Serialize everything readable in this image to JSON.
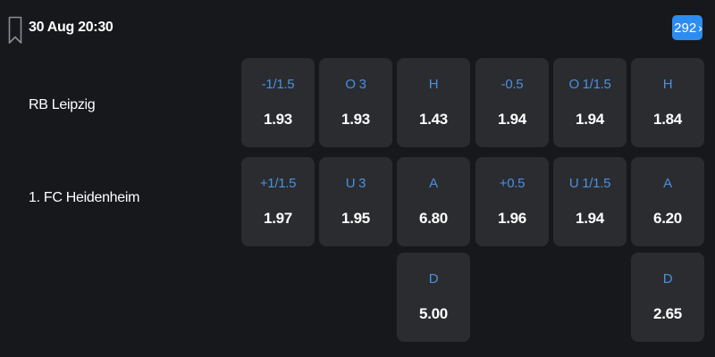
{
  "header": {
    "datetime": "30 Aug 20:30",
    "more_markets_count": "292",
    "more_markets_icon": "chevron-right-icon",
    "bookmark_icon": "bookmark-icon",
    "badge_color": "#2d8cf0"
  },
  "teams": {
    "home": "RB Leipzig",
    "away": "1. FC Heidenheim"
  },
  "odds": {
    "home": [
      {
        "label": "-1/1.5",
        "value": "1.93"
      },
      {
        "label": "O 3",
        "value": "1.93"
      },
      {
        "label": "H",
        "value": "1.43"
      },
      {
        "label": "-0.5",
        "value": "1.94"
      },
      {
        "label": "O 1/1.5",
        "value": "1.94"
      },
      {
        "label": "H",
        "value": "1.84"
      }
    ],
    "away": [
      {
        "label": "+1/1.5",
        "value": "1.97"
      },
      {
        "label": "U 3",
        "value": "1.95"
      },
      {
        "label": "A",
        "value": "6.80"
      },
      {
        "label": "+0.5",
        "value": "1.96"
      },
      {
        "label": "U 1/1.5",
        "value": "1.94"
      },
      {
        "label": "A",
        "value": "6.20"
      }
    ],
    "draw": [
      {
        "label": "D",
        "value": "5.00"
      },
      {
        "label": "D",
        "value": "2.65"
      }
    ]
  },
  "colors": {
    "background": "#16181c",
    "cell": "#2a2c30",
    "label": "#4a90e2",
    "value": "#ffffff"
  }
}
